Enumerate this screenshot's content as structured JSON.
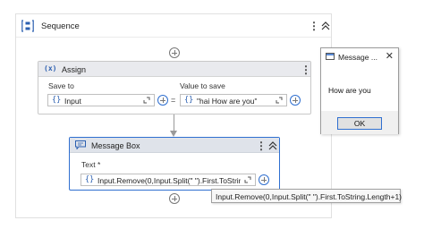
{
  "sequence": {
    "title": "Sequence"
  },
  "assign": {
    "title": "Assign",
    "icon_text": "(x)",
    "save_to_label": "Save to",
    "value_label": "Value to save",
    "save_to_value": "Input",
    "equals": "=",
    "value_value": "\"hai How are you\""
  },
  "message_box": {
    "title": "Message Box",
    "text_label": "Text *",
    "text_value": "Input.Remove(0,Input.Split(\" \").First.ToString",
    "tooltip": "Input.Remove(0,Input.Split(\" \").First.ToString.Length+1)"
  },
  "dialog": {
    "title": "Message ...",
    "body": "How are you",
    "ok_label": "OK"
  },
  "colors": {
    "accent": "#2f6fd0",
    "header_gray": "#e9eaee"
  },
  "icons": {
    "sequence": "sequence-icon",
    "assign": "assign-icon",
    "message_box": "message-box-icon",
    "expand": "expand-editor-icon",
    "add": "plus-circle-icon",
    "kebab": "kebab-menu-icon",
    "collapse": "chevron-up-icon",
    "close": "close-icon"
  }
}
